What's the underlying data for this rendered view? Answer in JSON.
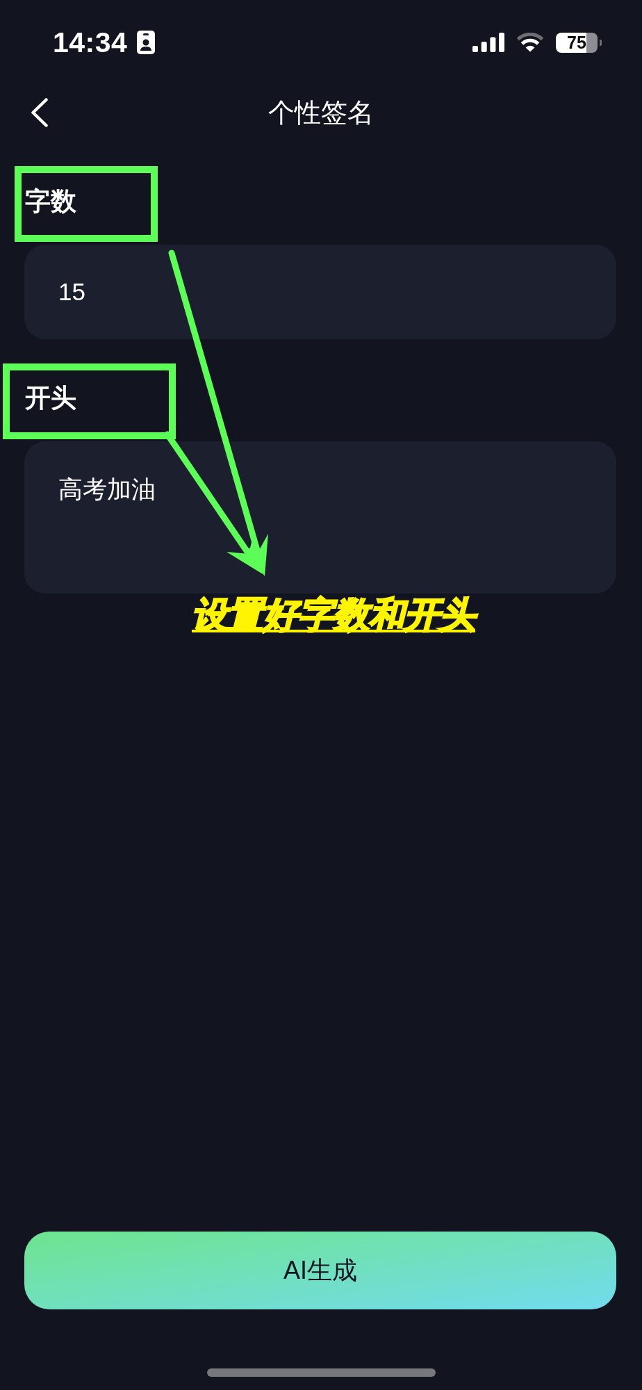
{
  "status_bar": {
    "time": "14:34",
    "battery": "75"
  },
  "header": {
    "title": "个性签名"
  },
  "fields": [
    {
      "kind": "single_line",
      "label": "字数",
      "value": "15",
      "highlighted": true
    },
    {
      "kind": "multi_line",
      "label": "开头",
      "value": "高考加油",
      "highlighted": true
    }
  ],
  "annotation": {
    "text": "设置好字数和开头"
  },
  "primary_button": {
    "label": "AI生成"
  }
}
